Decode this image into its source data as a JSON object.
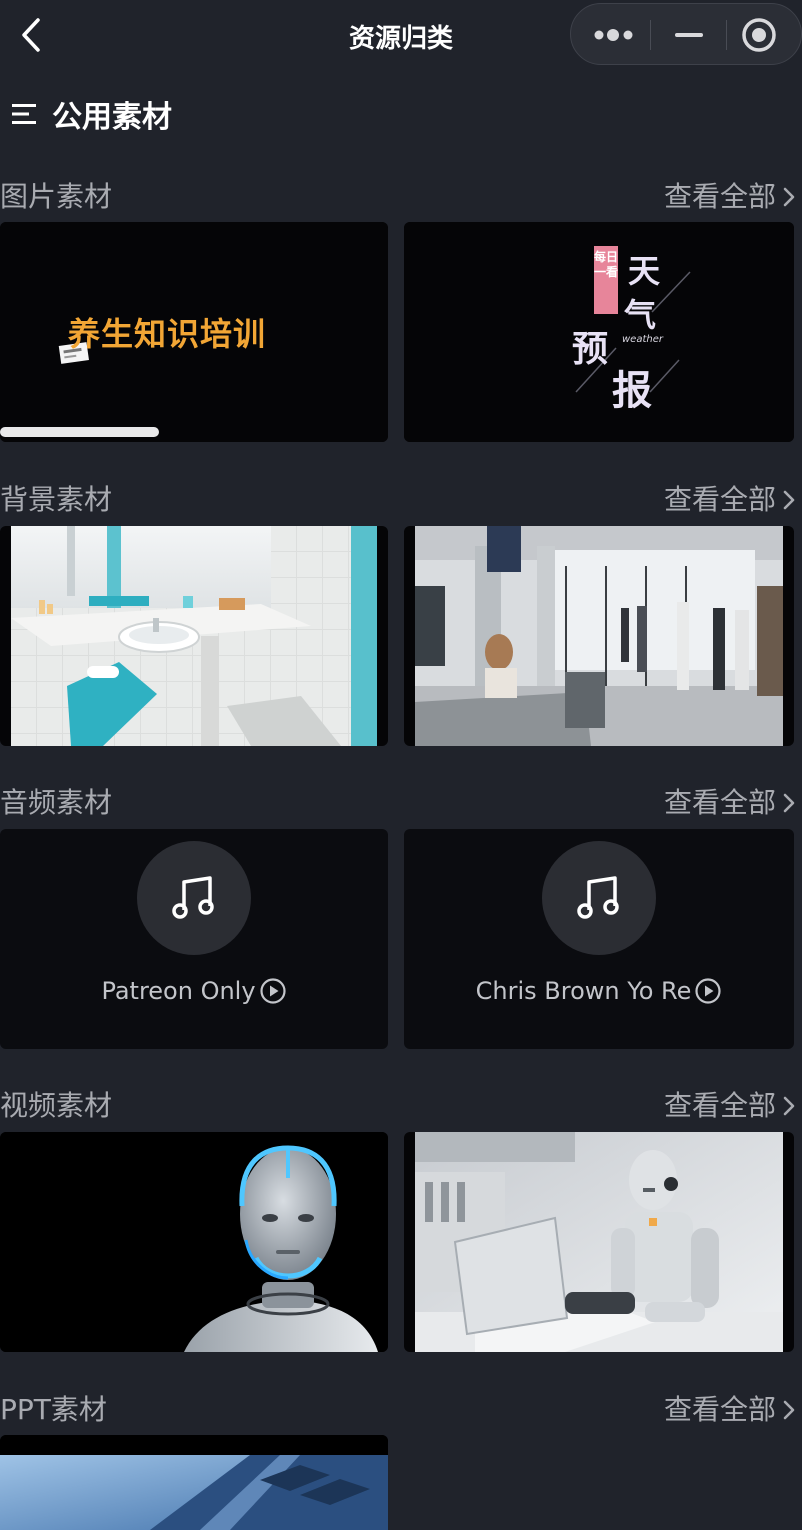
{
  "nav": {
    "title": "资源归类"
  },
  "header": {
    "title": "公用素材"
  },
  "sections": [
    {
      "title": "图片素材",
      "more": "查看全部"
    },
    {
      "title": "背景素材",
      "more": "查看全部"
    },
    {
      "title": "音频素材",
      "more": "查看全部"
    },
    {
      "title": "视频素材",
      "more": "查看全部"
    },
    {
      "title": "PPT素材",
      "more": "查看全部"
    }
  ],
  "image_cards": [
    {
      "text": "养生知识培训"
    },
    {
      "chars": [
        "天",
        "气",
        "预",
        "报"
      ],
      "en": "weather",
      "tag": "每日一看"
    }
  ],
  "audio_cards": [
    {
      "name": "Patreon Only"
    },
    {
      "name": "Chris Brown Yo Re"
    }
  ]
}
